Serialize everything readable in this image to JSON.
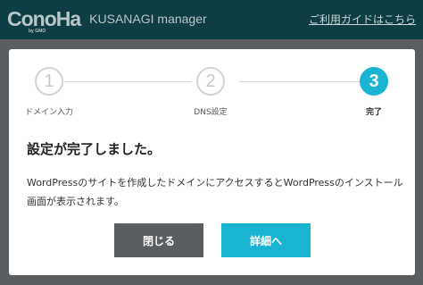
{
  "header": {
    "logo_text": "ConoHa",
    "logo_sub": "by GMO",
    "app_name": "KUSANAGI manager",
    "guide_link": "ご利用ガイドはこちら"
  },
  "steps": [
    {
      "number": "1",
      "label": "ドメイン入力",
      "state": "inactive"
    },
    {
      "number": "2",
      "label": "DNS設定",
      "state": "inactive"
    },
    {
      "number": "3",
      "label": "完了",
      "state": "active"
    }
  ],
  "modal": {
    "heading": "設定が完了しました。",
    "message": "WordPressのサイトを作成したドメインにアクセスするとWordPressのインストール画面が表示されます。",
    "close_button": "閉じる",
    "detail_button": "詳細へ"
  },
  "colors": {
    "accent": "#19b4d2",
    "topbar": "#0d3e44",
    "overlay": "#5b5e60",
    "secondary_button": "#5b5e60"
  }
}
